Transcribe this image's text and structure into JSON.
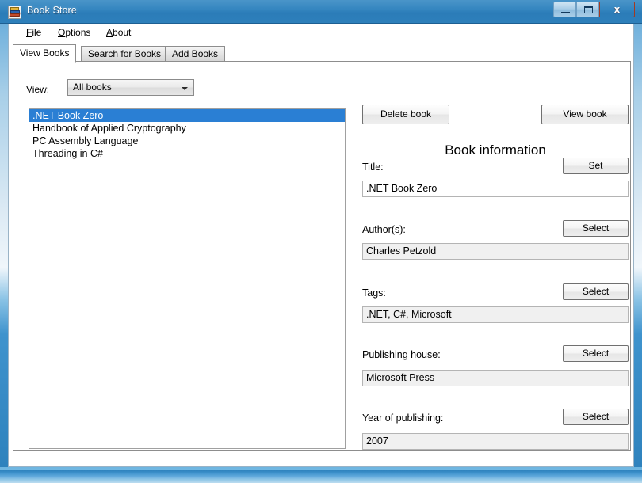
{
  "window": {
    "title": "Book Store",
    "icon": "books-stack-icon",
    "caption_buttons": {
      "minimize": "–",
      "maximize": "□",
      "close": "x"
    }
  },
  "menu": [
    {
      "accel": "F",
      "rest": "ile",
      "name": "menu-file"
    },
    {
      "accel": "O",
      "rest": "ptions",
      "name": "menu-options"
    },
    {
      "accel": "A",
      "rest": "bout",
      "name": "menu-about"
    }
  ],
  "tabs": [
    {
      "label": "View Books",
      "active": true
    },
    {
      "label": "Search for Books",
      "active": false
    },
    {
      "label": "Add Books",
      "active": false
    }
  ],
  "view_filter": {
    "label": "View:",
    "selected": "All books",
    "options": [
      "All books"
    ]
  },
  "book_list": {
    "items": [
      ".NET Book Zero",
      "Handbook of Applied Cryptography",
      "PC Assembly Language",
      "Threading in C#"
    ],
    "selected_index": 0
  },
  "actions": {
    "delete_book": "Delete book",
    "view_book": "View book"
  },
  "book_information": {
    "heading": "Book information",
    "fields": [
      {
        "label": "Title:",
        "button": "Set",
        "value": ".NET Book Zero",
        "editable": true,
        "name": "title"
      },
      {
        "label": "Author(s):",
        "button": "Select",
        "value": "Charles Petzold",
        "editable": false,
        "name": "authors"
      },
      {
        "label": "Tags:",
        "button": "Select",
        "value": ".NET, C#, Microsoft",
        "editable": false,
        "name": "tags"
      },
      {
        "label": "Publishing house:",
        "button": "Select",
        "value": "Microsoft Press",
        "editable": false,
        "name": "publishing-house"
      },
      {
        "label": "Year of publishing:",
        "button": "Select",
        "value": "2007",
        "editable": false,
        "name": "year-of-publishing"
      }
    ]
  },
  "colors": {
    "title_bar": "#2b7cb8",
    "selection": "#2a7fd4",
    "close_button": "#bb3a22",
    "readonly_field": "#f0f0f0"
  }
}
